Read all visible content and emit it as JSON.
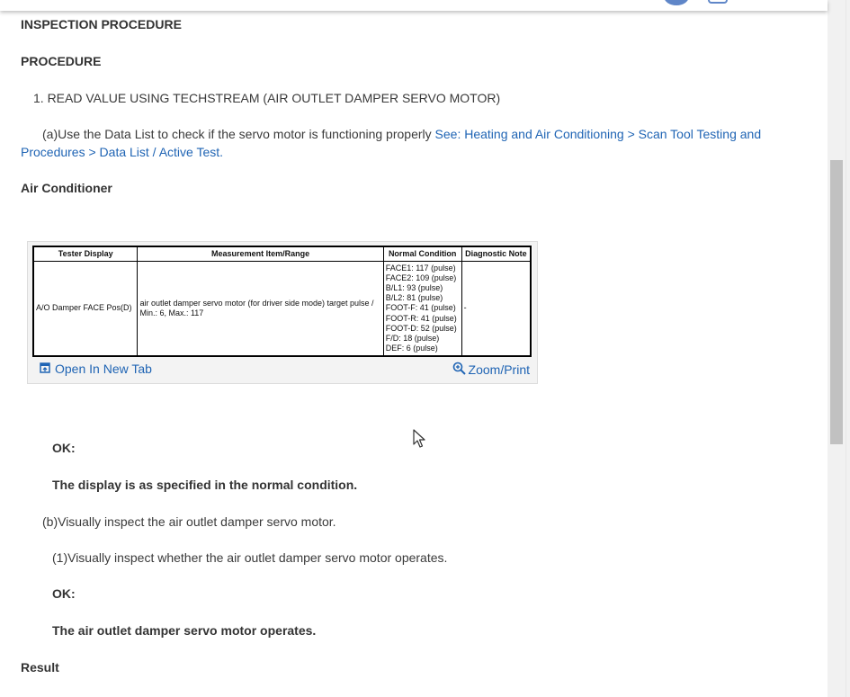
{
  "header": {
    "inspection_procedure": "INSPECTION PROCEDURE",
    "procedure": "PROCEDURE"
  },
  "step1": "1. READ VALUE USING TECHSTREAM (AIR OUTLET DAMPER SERVO MOTOR)",
  "step_a": {
    "text": "(a)Use the Data List to check if the servo motor is functioning properly ",
    "link": "See: Heating and Air Conditioning > Scan Tool Testing and Procedures > Data List / Active Test."
  },
  "air_conditioner": "Air Conditioner",
  "table": {
    "headers": [
      "Tester Display",
      "Measurement Item/Range",
      "Normal Condition",
      "Diagnostic Note"
    ],
    "row": {
      "tester_display": "A/O Damper FACE Pos(D)",
      "measurement": "air outlet damper servo motor (for driver side mode) target pulse / Min.: 6, Max.: 117",
      "normal_condition": [
        "FACE1: 117 (pulse)",
        "FACE2: 109 (pulse)",
        "B/L1: 93 (pulse)",
        "B/L2: 81 (pulse)",
        "FOOT-F: 41 (pulse)",
        "FOOT-R: 41 (pulse)",
        "FOOT-D: 52 (pulse)",
        "F/D: 18 (pulse)",
        "DEF: 6 (pulse)"
      ],
      "diagnostic_note": "-"
    }
  },
  "figure_bar": {
    "open_tab": "Open In New Tab",
    "zoom_print": "Zoom/Print"
  },
  "ok1_label": "OK:",
  "ok1_text": "The display is as specified in the normal condition.",
  "step_b": "(b)Visually inspect the air outlet damper servo motor.",
  "step_b1": "(1)Visually inspect whether the air outlet damper servo motor operates.",
  "ok2_label": "OK:",
  "ok2_text": "The air outlet damper servo motor operates.",
  "result": "Result",
  "colors": {
    "link": "#1f64b4",
    "text": "#3a3a3a",
    "scroll_thumb": "#c1c1c1"
  }
}
